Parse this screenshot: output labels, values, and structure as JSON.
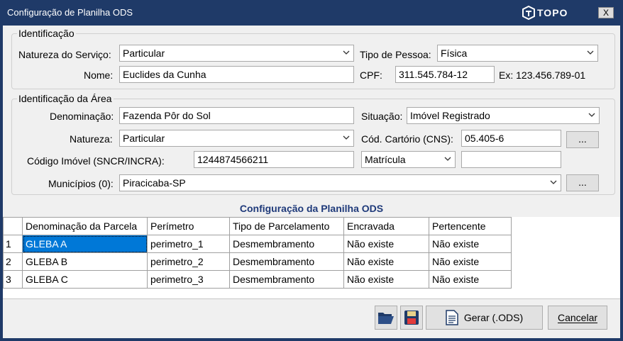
{
  "window": {
    "title": "Configuração de Planilha ODS",
    "logo_text": "TOPO",
    "close_label": "X"
  },
  "identificacao": {
    "legend": "Identificação",
    "natureza_servico_label": "Natureza do Serviço:",
    "natureza_servico_value": "Particular",
    "tipo_pessoa_label": "Tipo de Pessoa:",
    "tipo_pessoa_value": "Física",
    "nome_label": "Nome:",
    "nome_value": "Euclides da Cunha",
    "cpf_label": "CPF:",
    "cpf_value": "311.545.784-12",
    "cpf_example": "Ex: 123.456.789-01"
  },
  "area": {
    "legend": "Identificação da Área",
    "denominacao_label": "Denominação:",
    "denominacao_value": "Fazenda Pôr do Sol",
    "situacao_label": "Situação:",
    "situacao_value": "Imóvel Registrado",
    "natureza_label": "Natureza:",
    "natureza_value": "Particular",
    "cartorio_label": "Cód. Cartório (CNS):",
    "cartorio_value": "05.405-6",
    "browse_label": "...",
    "codigo_label": "Código Imóvel (SNCR/INCRA):",
    "codigo_value": "1244874566211",
    "matricula_value": "Matrícula",
    "matricula_number": "",
    "municipios_label": "Municípios (0):",
    "municipios_value": "Piracicaba-SP"
  },
  "grid": {
    "title": "Configuração da Planilha ODS",
    "columns": [
      "Denominação da Parcela",
      "Perímetro",
      "Tipo de Parcelamento",
      "Encravada",
      "Pertencente"
    ],
    "rows": [
      {
        "num": "1",
        "denominacao": "GLEBA A",
        "perimetro": "perimetro_1",
        "tipo": "Desmembramento",
        "encravada": "Não existe",
        "pertencente": "Não existe"
      },
      {
        "num": "2",
        "denominacao": "GLEBA B",
        "perimetro": "perimetro_2",
        "tipo": "Desmembramento",
        "encravada": "Não existe",
        "pertencente": "Não existe"
      },
      {
        "num": "3",
        "denominacao": "GLEBA C",
        "perimetro": "perimetro_3",
        "tipo": "Desmembramento",
        "encravada": "Não existe",
        "pertencente": "Não existe"
      }
    ]
  },
  "buttons": {
    "open_icon": "folder-open-icon",
    "save_icon": "floppy-disk-icon",
    "gerar_label": "Gerar (.ODS)",
    "gerar_icon": "document-icon",
    "cancelar_label": "Cancelar"
  },
  "colors": {
    "titlebar": "#1f3a68",
    "selection": "#0078d7",
    "grid_title": "#1f3a7a"
  }
}
